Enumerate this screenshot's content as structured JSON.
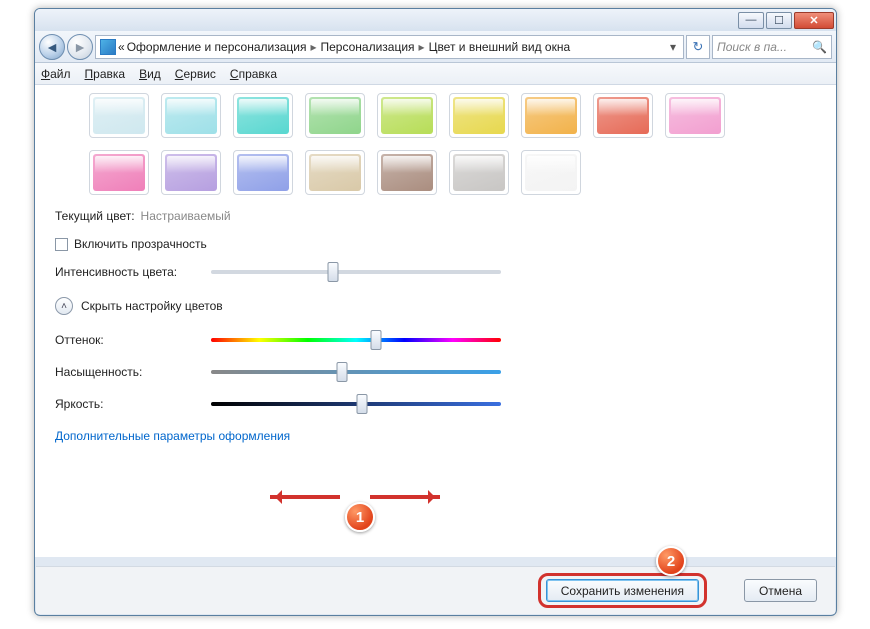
{
  "window": {
    "breadcrumb": {
      "prefix": "«",
      "items": [
        "Оформление и персонализация",
        "Персонализация",
        "Цвет и внешний вид окна"
      ]
    },
    "search_placeholder": "Поиск в па...",
    "menu": {
      "file": "Файл",
      "edit": "Правка",
      "view": "Вид",
      "service": "Сервис",
      "help": "Справка"
    }
  },
  "swatches": [
    "#cfe8ef",
    "#9ee0e8",
    "#58d7d0",
    "#8fd58b",
    "#b7dd57",
    "#e7d84e",
    "#f2b24a",
    "#e66a57",
    "#f29fd0",
    "#ef7fb9",
    "#b69fe0",
    "#8fa0e8",
    "#d9c9a8",
    "#aa8d7f",
    "#c8c6c4",
    "#f3f3f3"
  ],
  "main": {
    "current_color_label": "Текущий цвет:",
    "current_color_value": "Настраиваемый",
    "transparency_label": "Включить прозрачность",
    "intensity_label": "Интенсивность цвета:",
    "toggle_label": "Скрыть настройку цветов",
    "hue_label": "Оттенок:",
    "sat_label": "Насыщенность:",
    "bri_label": "Яркость:",
    "advanced_link": "Дополнительные параметры оформления",
    "sliders": {
      "intensity": 42,
      "hue": 57,
      "sat": 45,
      "bri": 52
    }
  },
  "footer": {
    "save": "Сохранить изменения",
    "cancel": "Отмена"
  },
  "callouts": {
    "one": "1",
    "two": "2"
  }
}
